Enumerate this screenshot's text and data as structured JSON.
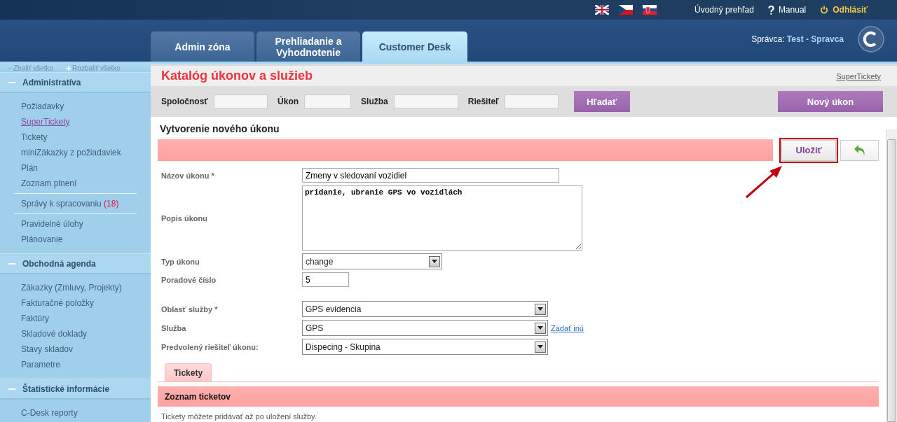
{
  "top_bar": {
    "languages": [
      {
        "kind": "uk"
      },
      {
        "kind": "cz"
      },
      {
        "kind": "sk"
      }
    ],
    "links": [
      {
        "kind": "plain",
        "label": "Úvodný prehľad"
      },
      {
        "kind": "help",
        "label": "Manual"
      },
      {
        "kind": "logout",
        "label": "Odhlásiť"
      }
    ]
  },
  "tabs": [
    {
      "label": "Admin zóna",
      "selected": false
    },
    {
      "label": "Prehliadanie a Vyhodnotenie",
      "selected": false
    },
    {
      "label": "Customer Desk",
      "selected": true
    }
  ],
  "user": {
    "role": "Správca:",
    "name": "Test - Spravca"
  },
  "sidebar": {
    "collapse_all": "Zbaliť všetko",
    "expand_all": "Rozbaliť všetko",
    "sections": [
      {
        "title": "Administratíva",
        "groups": [
          [
            {
              "label": "Požiadavky",
              "selected": false
            },
            {
              "label": "SuperTickety",
              "selected": true
            },
            {
              "label": "Tickety",
              "selected": false
            },
            {
              "label": "miniZákazky z požiadaviek",
              "selected": false
            },
            {
              "label": "Plán",
              "selected": false
            },
            {
              "label": "Zoznam plnení",
              "selected": false
            }
          ],
          [
            {
              "label": "Správy k spracovaniu",
              "count": "(18)",
              "selected": false
            }
          ],
          [
            {
              "label": "Pravidelné úlohy",
              "selected": false
            },
            {
              "label": "Plánovanie",
              "selected": false
            }
          ]
        ]
      },
      {
        "title": "Obchodná agenda",
        "groups": [
          [
            {
              "label": "Zákazky (Zmluvy, Projekty)",
              "selected": false
            },
            {
              "label": "Fakturačné položky",
              "selected": false
            },
            {
              "label": "Faktúry",
              "selected": false
            },
            {
              "label": "Skladové doklady",
              "selected": false
            },
            {
              "label": "Stavy skladov",
              "selected": false
            },
            {
              "label": "Parametre",
              "selected": false
            }
          ]
        ]
      },
      {
        "title": "Štatistické informácie",
        "groups": [
          [
            {
              "label": "C-Desk reporty",
              "selected": false
            }
          ]
        ]
      }
    ]
  },
  "page": {
    "title": "Katalóg úkonov a služieb",
    "breadcrumb_link": "SuperTickety"
  },
  "filters": {
    "fields": [
      "Spoločnosť",
      "Úkon",
      "Služba",
      "Riešiteľ"
    ],
    "search_button": "Hľadať",
    "new_button": "Nový úkon"
  },
  "form": {
    "title": "Vytvorenie nového úkonu",
    "save_button": {
      "label": "Uložiť",
      "highlighted": true
    },
    "field_groups": [
      [
        {
          "kind": "text",
          "label": "Názov úkonu *",
          "value": "Zmeny v sledovaní vozidiel"
        },
        {
          "kind": "textarea",
          "label": "Popis úkonu",
          "value": "pridanie, ubranie GPS vo vozidlách"
        },
        {
          "kind": "dropdown",
          "label": "Typ úkonu",
          "value": "change"
        },
        {
          "kind": "number",
          "label": "Poradové číslo",
          "value": "5"
        }
      ],
      [
        {
          "kind": "select",
          "label": "Oblasť služby *",
          "value": "GPS evidencia"
        },
        {
          "kind": "select",
          "label": "Služba",
          "value": "GPS",
          "link": "Zadať inú"
        },
        {
          "kind": "select",
          "label": "Predvolený riešiteľ úkonu:",
          "value": "Dispecing - Skupina"
        }
      ]
    ],
    "tabs": [
      {
        "label": "Tickety",
        "selected": true
      }
    ],
    "ticket_list": {
      "title": "Zoznam ticketov",
      "note": "Tickety môžete pridávať až po uložení služby."
    }
  }
}
